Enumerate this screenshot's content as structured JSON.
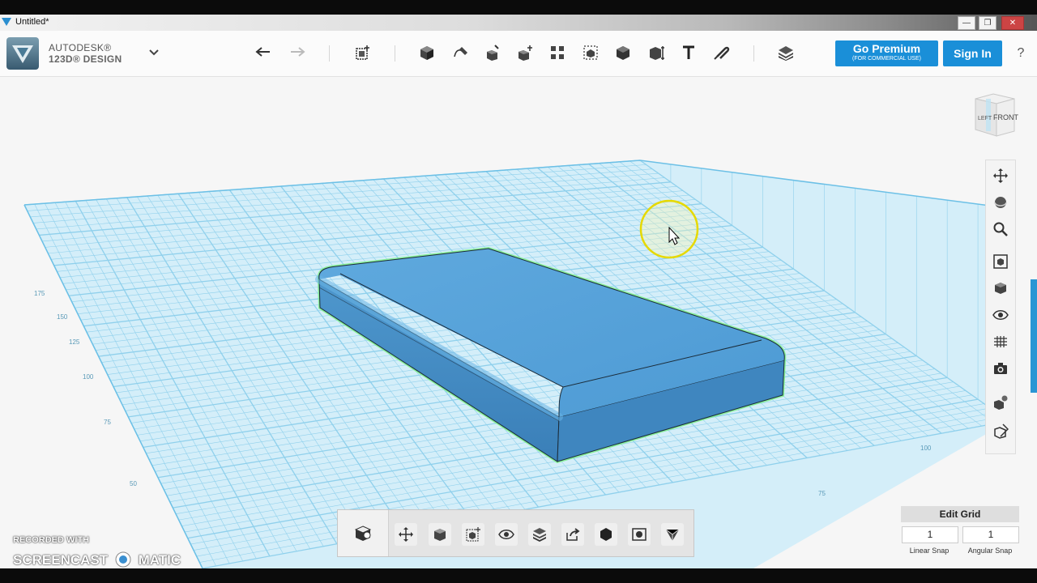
{
  "window": {
    "title": "Untitled*",
    "controls": {
      "minimize": "—",
      "maximize": "❐",
      "close": "✕"
    }
  },
  "brand": {
    "line1": "AUTODESK®",
    "line2": "123D® DESIGN",
    "menu_icon": "chevron-down-icon"
  },
  "toolbar": {
    "tools": [
      "undo-icon",
      "redo-icon",
      "transform-icon",
      "primitives-icon",
      "sketch-icon",
      "construct-icon",
      "modify-icon",
      "pattern-icon",
      "grouping-icon",
      "combine-icon",
      "measure-icon",
      "text-icon",
      "snap-icon",
      "material-icon"
    ]
  },
  "premium": {
    "title": "Go Premium",
    "subtitle": "(FOR COMMERCIAL USE)"
  },
  "signin": {
    "label": "Sign In"
  },
  "help": {
    "label": "?"
  },
  "viewcube": {
    "left_label": "LEFT",
    "front_label": "FRONT"
  },
  "nav_tools": [
    "pan-icon",
    "orbit-icon",
    "zoom-icon",
    "fit-icon",
    "view-cube-icon",
    "visibility-icon",
    "grid-icon",
    "camera-icon",
    "materials-icon",
    "outline-icon"
  ],
  "bottom_tools": [
    "solid-icon",
    "move-icon",
    "box-icon",
    "fit-box-icon",
    "eye-icon",
    "layers-icon",
    "export-icon",
    "hexagon-icon",
    "screenshot-icon",
    "vertex-icon"
  ],
  "edit_grid": {
    "header": "Edit Grid",
    "linear_value": "1",
    "angular_value": "1",
    "linear_label": "Linear Snap",
    "angular_label": "Angular Snap"
  },
  "grid_labels": [
    "175",
    "150",
    "125",
    "100",
    "75",
    "50",
    "75",
    "100"
  ],
  "watermark": {
    "line1": "RECORDED WITH",
    "line2": "SCREENCAST",
    "line3": "MATIC"
  },
  "colors": {
    "accent": "#1a8fd8",
    "grid": "#7cc6e8",
    "model": "#5aa6dc",
    "highlight": "#7bf08a"
  }
}
